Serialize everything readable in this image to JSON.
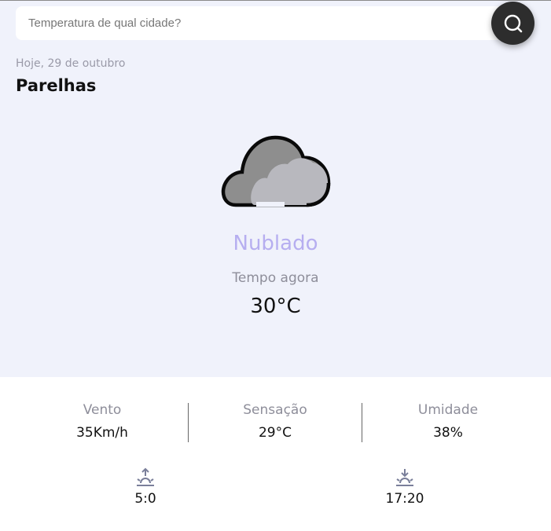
{
  "search": {
    "placeholder": "Temperatura de qual cidade?"
  },
  "header": {
    "date": "Hoje, 29 de outubro",
    "city": "Parelhas"
  },
  "weather": {
    "icon": "cloudy-icon",
    "condition": "Nublado",
    "now_label": "Tempo agora",
    "temperature": "30°C"
  },
  "stats": [
    {
      "label": "Vento",
      "value": "35Km/h"
    },
    {
      "label": "Sensação",
      "value": "29°C"
    },
    {
      "label": "Umidade",
      "value": "38%"
    }
  ],
  "sun": {
    "sunrise": "5:0",
    "sunset": "17:20"
  },
  "colors": {
    "accent": "#b6aef0",
    "background": "#f0f2fb",
    "search_button": "#2d2d2d"
  }
}
